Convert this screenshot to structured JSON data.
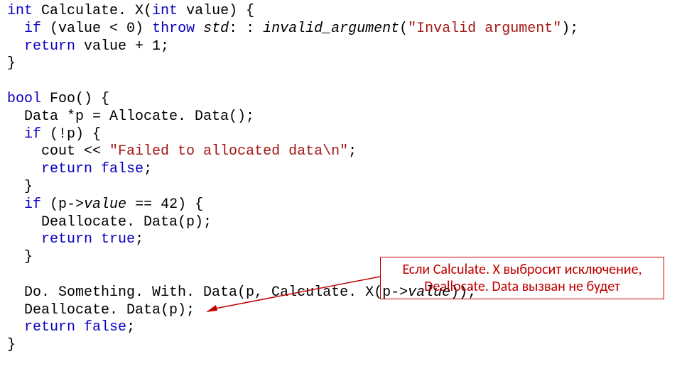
{
  "code": {
    "l1a": "int",
    "l1b": " Calculate. X(",
    "l1c": "int",
    "l1d": " value) {",
    "l2a": "  ",
    "l2b": "if",
    "l2c": " (value < 0) ",
    "l2d": "throw",
    "l2e": " ",
    "l2f": "std",
    "l2g": ": : ",
    "l2h": "invalid_argument",
    "l2i": "(",
    "l2j": "\"Invalid argument\"",
    "l2k": ");",
    "l3a": "  ",
    "l3b": "return",
    "l3c": " value + 1;",
    "l4": "}",
    "l5": "",
    "l6a": "bool",
    "l6b": " Foo() {",
    "l7a": "  Data *p = Allocate. Data();",
    "l8a": "  ",
    "l8b": "if",
    "l8c": " (!p) {",
    "l9a": "    cout << ",
    "l9b": "\"Failed to allocated data\\n\"",
    "l9c": ";",
    "l10a": "    ",
    "l10b": "return",
    "l10c": " ",
    "l10d": "false",
    "l10e": ";",
    "l11": "  }",
    "l12a": "  ",
    "l12b": "if",
    "l12c": " (p->",
    "l12d": "value",
    "l12e": " == 42) {",
    "l13": "    Deallocate. Data(p);",
    "l14a": "    ",
    "l14b": "return",
    "l14c": " ",
    "l14d": "true",
    "l14e": ";",
    "l15": "  }",
    "l16": "",
    "l17a": "  Do. Something. With. Data(p, Calculate. X(p->",
    "l17b": "value",
    "l17c": "));",
    "l18": "  Deallocate. Data(p);",
    "l19a": "  ",
    "l19b": "return",
    "l19c": " ",
    "l19d": "false",
    "l19e": ";",
    "l20": "}"
  },
  "annotation": {
    "line1": "Если Calculate. X выбросит исключение,",
    "line2": "Deallocate. Data вызван не будет"
  }
}
